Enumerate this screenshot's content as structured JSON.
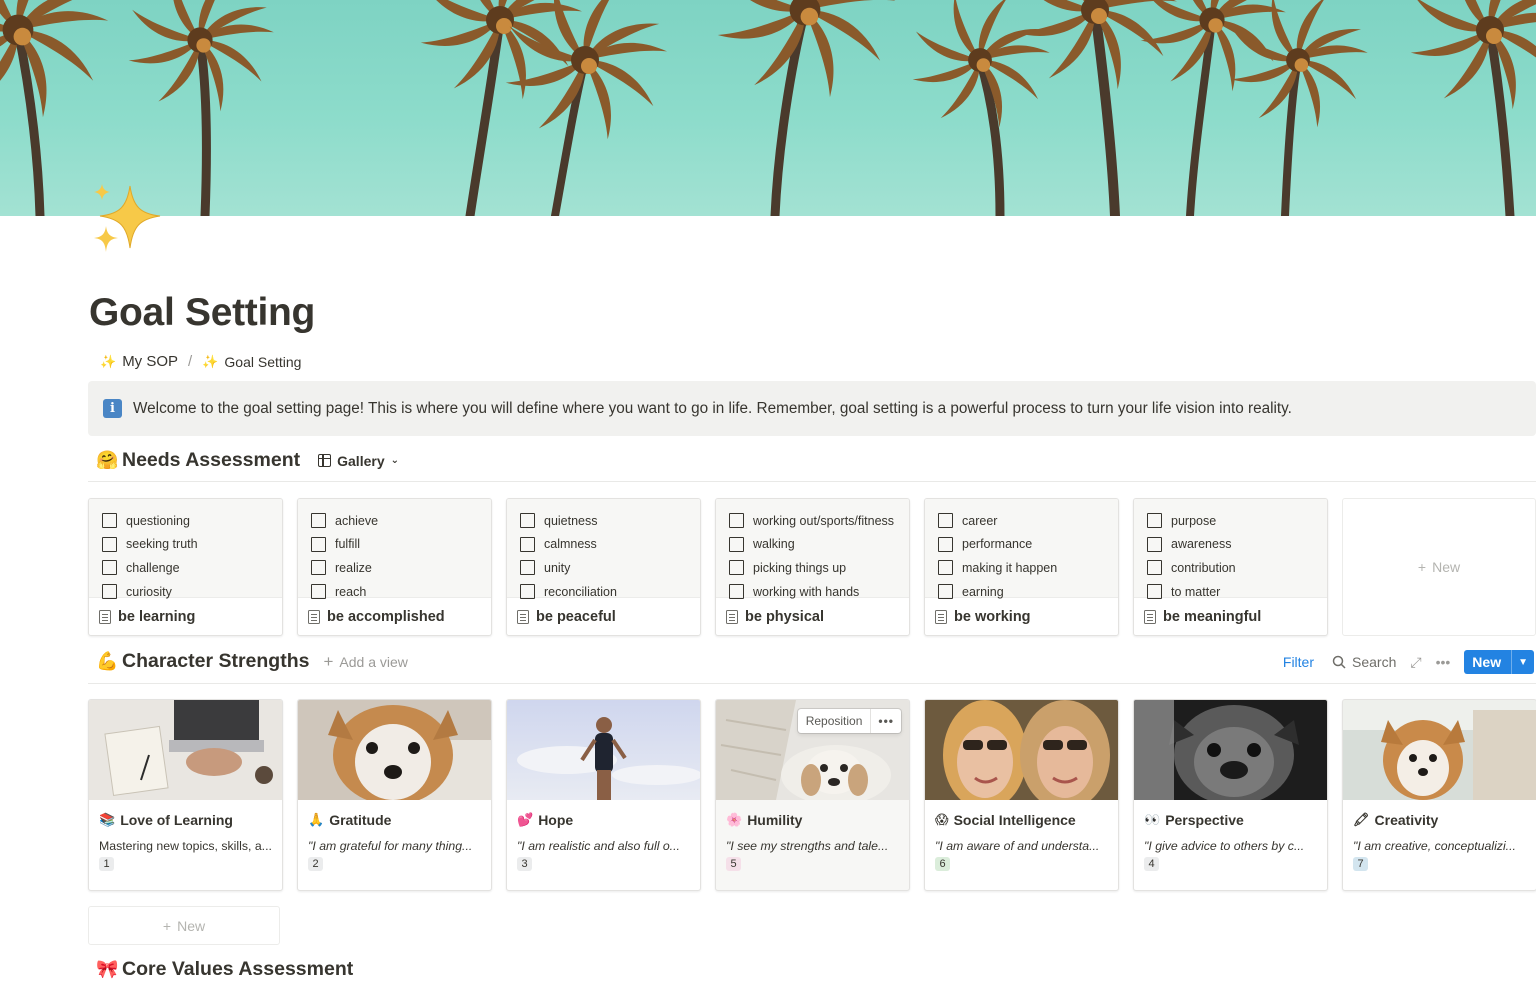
{
  "page": {
    "title": "Goal Setting",
    "breadcrumb": [
      {
        "label": "My SOP"
      },
      {
        "label": "Goal Setting"
      }
    ],
    "callout": "Welcome to the goal setting page! This is where you will define where you want to go in life. Remember, goal setting is a powerful process to turn your life vision into reality."
  },
  "needs": {
    "title": "Needs Assessment",
    "view_label": "Gallery",
    "new_label": "New",
    "cards": [
      {
        "title": "be learning",
        "items": [
          "questioning",
          "seeking truth",
          "challenge",
          "curiosity"
        ]
      },
      {
        "title": "be accomplished",
        "items": [
          "achieve",
          "fulfill",
          "realize",
          "reach"
        ]
      },
      {
        "title": "be peaceful",
        "items": [
          "quietness",
          "calmness",
          "unity",
          "reconciliation"
        ]
      },
      {
        "title": "be physical",
        "items": [
          "working out/sports/fitness",
          "walking",
          "picking things up",
          "working with hands"
        ]
      },
      {
        "title": "be working",
        "items": [
          "career",
          "performance",
          "making it happen",
          "earning"
        ]
      },
      {
        "title": "be meaningful",
        "items": [
          "purpose",
          "awareness",
          "contribution",
          "to matter"
        ]
      }
    ]
  },
  "strengths": {
    "title": "Character Strengths",
    "add_view_label": "Add a view",
    "toolbar": {
      "filter": "Filter",
      "search": "Search",
      "new": "New"
    },
    "reposition_label": "Reposition",
    "new_row_label": "New",
    "cards": [
      {
        "emoji": "📚",
        "title": "Love of Learning",
        "quote": "Mastering new topics, skills, a...",
        "italic": false,
        "num": "1",
        "badge_color": "#ebeced"
      },
      {
        "emoji": "🙏",
        "title": "Gratitude",
        "quote": "\"I am grateful for many thing...",
        "italic": true,
        "num": "2",
        "badge_color": "#ebeced"
      },
      {
        "emoji": "💕",
        "title": "Hope",
        "quote": "\"I am realistic and also full o...",
        "italic": true,
        "num": "3",
        "badge_color": "#ebeced"
      },
      {
        "emoji": "🌸",
        "title": "Humility",
        "quote": "\"I see my strengths and tale...",
        "italic": true,
        "num": "5",
        "badge_color": "#f5e0e9"
      },
      {
        "emoji": "😱",
        "title": "Social Intelligence",
        "quote": "\"I am aware of and understa...",
        "italic": true,
        "num": "6",
        "badge_color": "#dbeddb"
      },
      {
        "emoji": "👀",
        "title": "Perspective",
        "quote": "\"I give advice to others by c...",
        "italic": true,
        "num": "4",
        "badge_color": "#ebeced"
      },
      {
        "emoji": "🖍",
        "title": "Creativity",
        "quote": "\"I am creative, conceptualizi...",
        "italic": true,
        "num": "7",
        "badge_color": "#d3e5ef"
      }
    ]
  },
  "core_values": {
    "title": "Core Values Assessment"
  },
  "icons": [
    "sparkles-icon",
    "info-icon",
    "hug-icon",
    "muscle-icon",
    "bow-icon",
    "page-icon",
    "checkbox-icon",
    "search-icon",
    "expand-icon",
    "more-icon",
    "chevron-down-icon",
    "plus-icon"
  ],
  "colors": {
    "accent": "#2383e2",
    "text": "#37352f",
    "muted": "#9b9a97",
    "callout_bg": "#f1f1ef",
    "cover_sky": "#8ddccb"
  }
}
